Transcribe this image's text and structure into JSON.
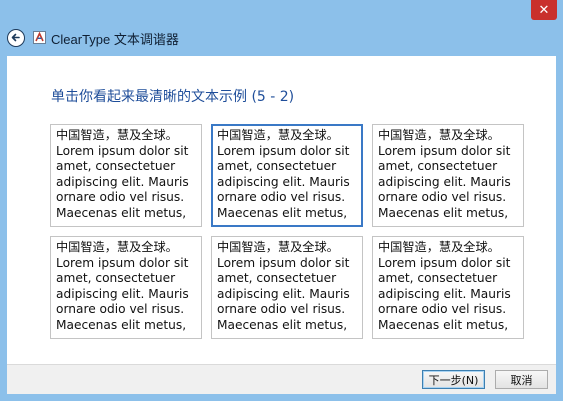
{
  "window": {
    "title": "ClearType 文本调谐器",
    "close_glyph": "✕"
  },
  "main": {
    "heading": "单击你看起来最清晰的文本示例 (5 - 2)",
    "selected_index": 1,
    "samples": [
      {
        "lines": [
          "中国智造，慧及全球。",
          "Lorem ipsum dolor sit",
          "amet, consectetuer",
          "adipiscing elit. Mauris",
          "ornare odio vel risus.",
          "Maecenas elit metus,"
        ]
      },
      {
        "lines": [
          "中国智造，慧及全球。",
          "Lorem ipsum dolor sit",
          "amet, consectetuer",
          "adipiscing elit. Mauris",
          "ornare odio vel risus.",
          "Maecenas elit metus,"
        ]
      },
      {
        "lines": [
          "中国智造，慧及全球。",
          "Lorem ipsum dolor sit",
          "amet, consectetuer",
          "adipiscing elit. Mauris",
          "ornare odio vel risus.",
          "Maecenas elit metus,"
        ]
      },
      {
        "lines": [
          "中国智造，慧及全球。",
          "Lorem ipsum dolor sit",
          "amet, consectetuer",
          "adipiscing elit. Mauris",
          "ornare odio vel risus.",
          "Maecenas elit metus,"
        ]
      },
      {
        "lines": [
          "中国智造，慧及全球。",
          "Lorem ipsum dolor sit",
          "amet, consectetuer",
          "adipiscing elit. Mauris",
          "ornare odio vel risus.",
          "Maecenas elit metus,"
        ]
      },
      {
        "lines": [
          "中国智造，慧及全球。",
          "Lorem ipsum dolor sit",
          "amet, consectetuer",
          "adipiscing elit. Mauris",
          "ornare odio vel risus.",
          "Maecenas elit metus,"
        ]
      }
    ]
  },
  "footer": {
    "next_label": "下一步(N)",
    "cancel_label": "取消"
  },
  "colors": {
    "frame": "#8cc0ea",
    "heading": "#1f4e9a",
    "selected_border": "#3a79c6",
    "close": "#c9302c"
  },
  "icons": {
    "back": "back-arrow-icon",
    "app": "cleartype-app-icon",
    "close": "close-icon"
  }
}
